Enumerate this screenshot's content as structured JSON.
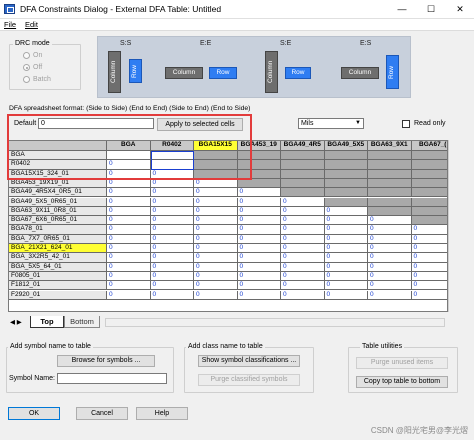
{
  "window": {
    "title": "DFA Constraints Dialog - External DFA Table: Untitled",
    "min": "—",
    "max": "☐",
    "close": "✕"
  },
  "menu": {
    "file": "File",
    "edit": "Edit"
  },
  "drc_mode": {
    "title": "DRC mode",
    "options": [
      "On",
      "Off",
      "Batch"
    ],
    "selected": "Off"
  },
  "diagram": {
    "labels": [
      "S:S",
      "E:E",
      "S:E",
      "E:S"
    ],
    "column": "Column",
    "row": "Row"
  },
  "format_text": "DFA spreadsheet format: (Side to Side) (End to End) (Side to End) (End to Side)",
  "default": {
    "label": "Default",
    "value": "0"
  },
  "apply_button": "Apply to selected cells",
  "units": {
    "value": "Mils"
  },
  "read_only": {
    "label": "Read only",
    "checked": false
  },
  "table": {
    "columns": [
      "BGA",
      "R0402",
      "BGA15X15",
      "BGA453_19",
      "BGA49_4R5",
      "BGA49_5X5",
      "BGA63_9X1",
      "BGA67_("
    ],
    "highlight_column": 2,
    "rows": [
      {
        "name": "BGA",
        "cells": [
          "",
          "",
          "",
          "",
          "",
          "",
          "",
          ""
        ],
        "sel": true
      },
      {
        "name": "R0402",
        "cells": [
          "0",
          "",
          "",
          "",
          "",
          "",
          "",
          ""
        ],
        "sel": true
      },
      {
        "name": "BGA15X15_324_01",
        "cells": [
          "0",
          "0",
          "",
          "",
          "",
          "",
          "",
          ""
        ]
      },
      {
        "name": "BGA453_19X19_01",
        "cells": [
          "0",
          "0",
          "0",
          "",
          "",
          "",
          "",
          ""
        ]
      },
      {
        "name": "BGA49_4R5X4_0R5_01",
        "cells": [
          "0",
          "0",
          "0",
          "0",
          "",
          "",
          "",
          ""
        ]
      },
      {
        "name": "BGA49_5X5_0R65_01",
        "cells": [
          "0",
          "0",
          "0",
          "0",
          "0",
          "",
          "",
          ""
        ]
      },
      {
        "name": "BGA63_9X11_0R8_01",
        "cells": [
          "0",
          "0",
          "0",
          "0",
          "0",
          "0",
          "",
          ""
        ]
      },
      {
        "name": "BGA67_6X6_0R65_01",
        "cells": [
          "0",
          "0",
          "0",
          "0",
          "0",
          "0",
          "0",
          ""
        ]
      },
      {
        "name": "BGA78_01",
        "cells": [
          "0",
          "0",
          "0",
          "0",
          "0",
          "0",
          "0",
          "0"
        ]
      },
      {
        "name": "BGA_7X7_0R65_01",
        "cells": [
          "0",
          "0",
          "0",
          "0",
          "0",
          "0",
          "0",
          "0"
        ]
      },
      {
        "name": "BGA_21X21_624_01",
        "cells": [
          "0",
          "0",
          "0",
          "0",
          "0",
          "0",
          "0",
          "0"
        ],
        "hl": true
      },
      {
        "name": "BGA_3X2R5_42_01",
        "cells": [
          "0",
          "0",
          "0",
          "0",
          "0",
          "0",
          "0",
          "0"
        ]
      },
      {
        "name": "BGA_5X5_64_01",
        "cells": [
          "0",
          "0",
          "0",
          "0",
          "0",
          "0",
          "0",
          "0"
        ]
      },
      {
        "name": "F0805_01",
        "cells": [
          "0",
          "0",
          "0",
          "0",
          "0",
          "0",
          "0",
          "0"
        ]
      },
      {
        "name": "F1812_01",
        "cells": [
          "0",
          "0",
          "0",
          "0",
          "0",
          "0",
          "0",
          "0"
        ]
      },
      {
        "name": "F2920_01",
        "cells": [
          "0",
          "0",
          "0",
          "0",
          "0",
          "0",
          "0",
          "0"
        ]
      }
    ]
  },
  "tabs": {
    "top": "Top",
    "bottom": "Bottom"
  },
  "add_symbol": {
    "title": "Add symbol name to table",
    "browse": "Browse for symbols ...",
    "symbol_label": "Symbol Name:",
    "symbol_value": ""
  },
  "add_class": {
    "title": "Add class name to table",
    "show": "Show symbol classifications ...",
    "purge": "Purge classified symbols"
  },
  "utilities": {
    "title": "Table utilities",
    "purge": "Purge unused items",
    "copy": "Copy top table to bottom"
  },
  "footer": {
    "ok": "OK",
    "cancel": "Cancel",
    "help": "Help"
  },
  "watermark": "CSDN @阳光宅男@李光熠",
  "colors": {
    "selection": "#e23b3b",
    "highlight": "#ffff33",
    "value": "#1a3fd0"
  }
}
